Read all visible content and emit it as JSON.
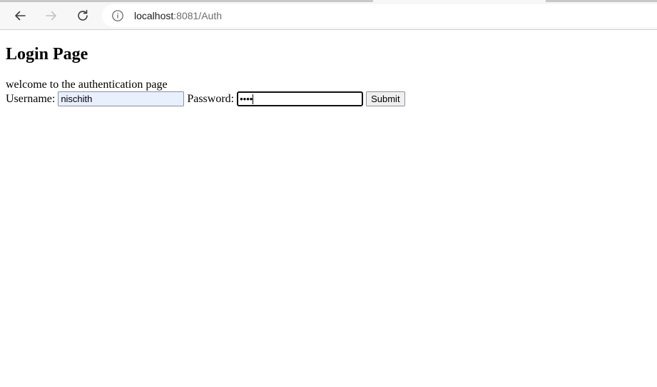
{
  "browser": {
    "url_host": "localhost",
    "url_path": ":8081/Auth",
    "icons": {
      "back": "arrow-left-icon",
      "forward": "arrow-right-icon",
      "reload": "reload-icon",
      "site_info": "info-icon"
    }
  },
  "page": {
    "title": "Login Page",
    "welcome_text": "welcome to the authentication page"
  },
  "form": {
    "username_label": "Username: ",
    "username_value": "nischith",
    "password_label": " Password: ",
    "password_masked": "••••",
    "submit_label": "Submit"
  },
  "colors": {
    "autofill_bg": "#e8f0fe",
    "chrome_bg": "#f7f7f7"
  }
}
